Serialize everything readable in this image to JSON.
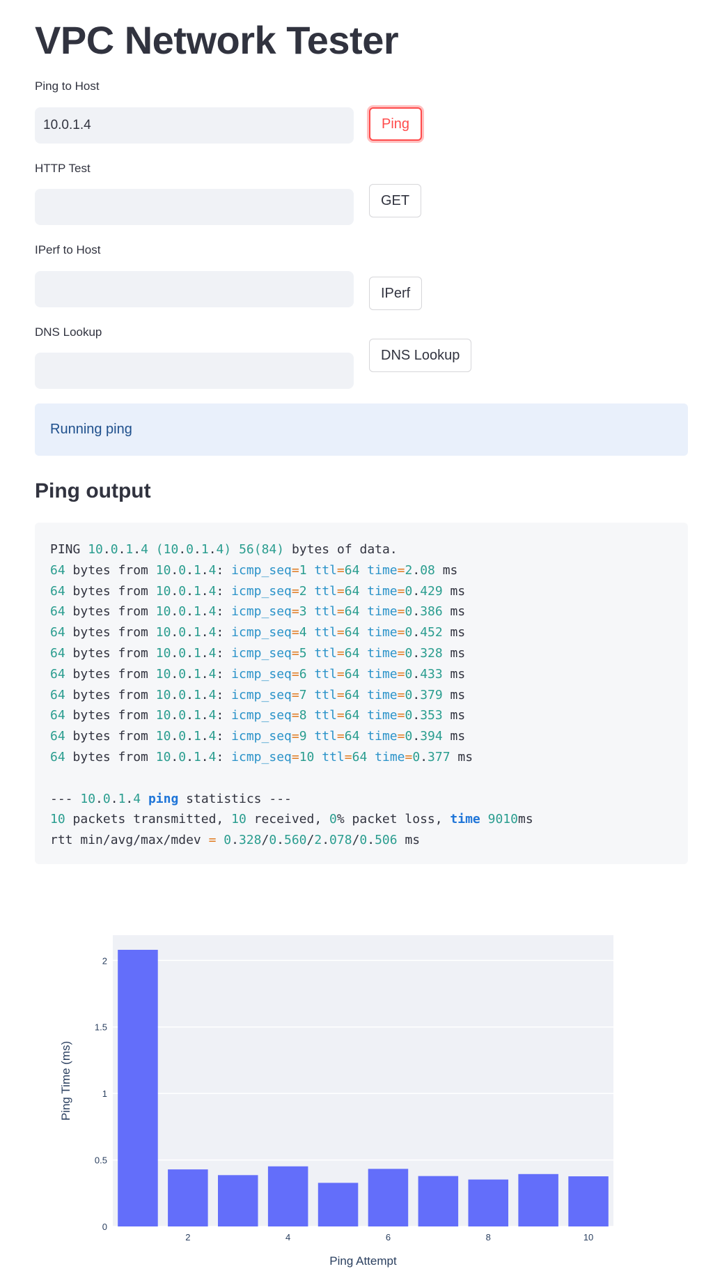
{
  "app": {
    "title": "VPC Network Tester"
  },
  "forms": {
    "ping": {
      "label": "Ping to Host",
      "value": "10.0.1.4",
      "button": "Ping"
    },
    "http": {
      "label": "HTTP Test",
      "value": "",
      "button": "GET"
    },
    "iperf": {
      "label": "IPerf to Host",
      "value": "",
      "button": "IPerf"
    },
    "dns": {
      "label": "DNS Lookup",
      "value": "",
      "button": "DNS Lookup"
    }
  },
  "status": {
    "message": "Running ping"
  },
  "output": {
    "heading": "Ping output",
    "lines": [
      "PING 10.0.1.4 (10.0.1.4) 56(84) bytes of data.",
      "64 bytes from 10.0.1.4: icmp_seq=1 ttl=64 time=2.08 ms",
      "64 bytes from 10.0.1.4: icmp_seq=2 ttl=64 time=0.429 ms",
      "64 bytes from 10.0.1.4: icmp_seq=3 ttl=64 time=0.386 ms",
      "64 bytes from 10.0.1.4: icmp_seq=4 ttl=64 time=0.452 ms",
      "64 bytes from 10.0.1.4: icmp_seq=5 ttl=64 time=0.328 ms",
      "64 bytes from 10.0.1.4: icmp_seq=6 ttl=64 time=0.433 ms",
      "64 bytes from 10.0.1.4: icmp_seq=7 ttl=64 time=0.379 ms",
      "64 bytes from 10.0.1.4: icmp_seq=8 ttl=64 time=0.353 ms",
      "64 bytes from 10.0.1.4: icmp_seq=9 ttl=64 time=0.394 ms",
      "64 bytes from 10.0.1.4: icmp_seq=10 ttl=64 time=0.377 ms",
      "",
      "--- 10.0.1.4 ping statistics ---",
      "10 packets transmitted, 10 received, 0% packet loss, time 9010ms",
      "rtt min/avg/max/mdev = 0.328/0.560/2.078/0.506 ms"
    ]
  },
  "colors": {
    "accent": "#FF4B4B",
    "bar": "#636EFA",
    "plot_bg": "#EFF1F6",
    "info_bg": "#E9F0FB",
    "info_text": "#1E4F8C"
  },
  "chart_data": {
    "type": "bar",
    "x": [
      1,
      2,
      3,
      4,
      5,
      6,
      7,
      8,
      9,
      10
    ],
    "values": [
      2.08,
      0.429,
      0.386,
      0.452,
      0.328,
      0.433,
      0.379,
      0.353,
      0.394,
      0.377
    ],
    "xlabel": "Ping Attempt",
    "ylabel": "Ping Time (ms)",
    "ylim": [
      0,
      2.19
    ],
    "xticks": [
      "2",
      "4",
      "6",
      "8",
      "10"
    ],
    "yticks": [
      "0",
      "0.5",
      "1",
      "1.5",
      "2"
    ],
    "grid": true,
    "legend": "none"
  }
}
